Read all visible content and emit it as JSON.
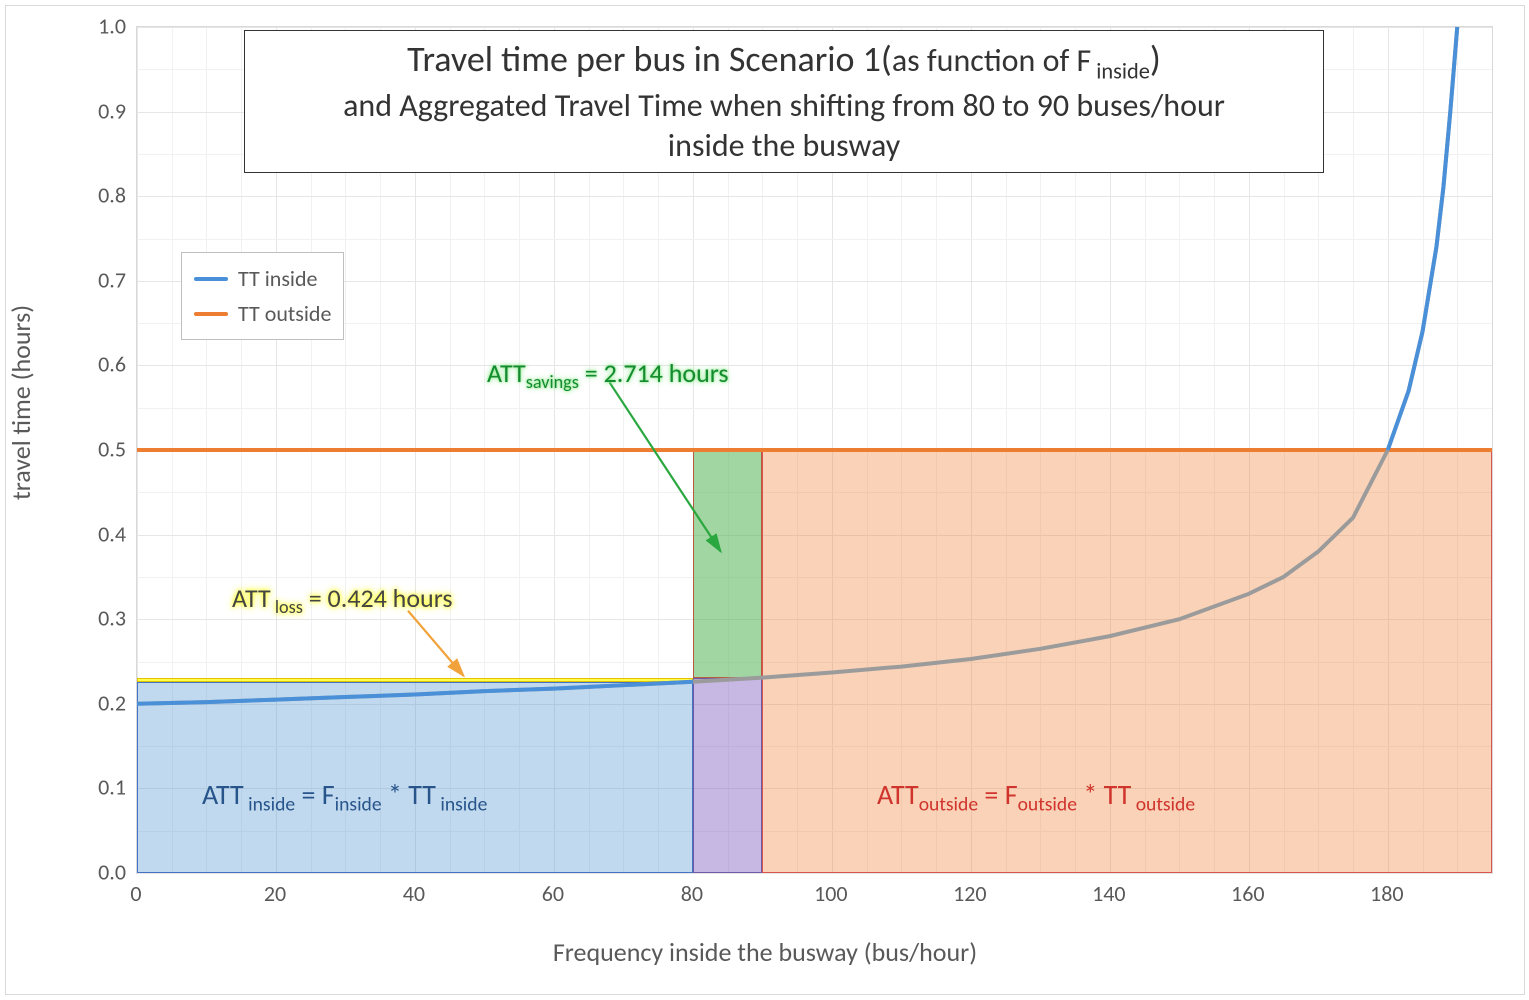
{
  "title_line1_a": "Travel time per bus in Scenario 1(",
  "title_line1_b": "as function of F",
  "title_line1_sub": " inside",
  "title_line1_c": ")",
  "title_line2": "and Aggregated Travel Time when shifting from 80 to 90 buses/hour",
  "title_line3": "inside the busway",
  "x_axis_label": "Frequency inside the busway (bus/hour)",
  "y_axis_label": "travel time  (hours)",
  "legend": {
    "inside": "TT inside",
    "outside": "TT outside"
  },
  "annotations": {
    "savings_prefix": "ATT",
    "savings_sub": "savings",
    "savings_rest": " = 2.714 hours",
    "loss_prefix": "ATT",
    "loss_sub": " loss",
    "loss_rest": " = 0.424 hours",
    "inside_prefix": "ATT",
    "inside_sub": " inside",
    "inside_mid": " = F",
    "inside_sub2": "inside",
    "inside_mid2": " * TT",
    "inside_sub3": " inside",
    "outside_prefix": "ATT",
    "outside_sub": "outside",
    "outside_mid": " = F",
    "outside_sub2": "outside",
    "outside_mid2": " * TT",
    "outside_sub3": " outside"
  },
  "x_ticks": [
    "0",
    "20",
    "40",
    "60",
    "80",
    "100",
    "120",
    "140",
    "160",
    "180"
  ],
  "y_ticks": [
    "0.0",
    "0.1",
    "0.2",
    "0.3",
    "0.4",
    "0.5",
    "0.6",
    "0.7",
    "0.8",
    "0.9",
    "1.0"
  ],
  "chart_data": {
    "type": "line",
    "xlabel": "Frequency inside the busway (bus/hour)",
    "ylabel": "travel time (hours)",
    "xlim": [
      0,
      195
    ],
    "ylim": [
      0.0,
      1.0
    ],
    "series": [
      {
        "name": "TT outside",
        "color": "#ed7d31",
        "x": [
          0,
          195
        ],
        "values": [
          0.5,
          0.5
        ]
      },
      {
        "name": "TT inside",
        "color": "#4a90d9",
        "x": [
          0,
          10,
          20,
          30,
          40,
          50,
          60,
          70,
          80,
          90,
          100,
          110,
          120,
          130,
          140,
          150,
          160,
          165,
          170,
          175,
          180,
          183,
          185,
          187,
          188,
          189,
          190
        ],
        "values": [
          0.2,
          0.202,
          0.205,
          0.208,
          0.211,
          0.215,
          0.218,
          0.222,
          0.226,
          0.231,
          0.237,
          0.244,
          0.253,
          0.265,
          0.28,
          0.3,
          0.33,
          0.35,
          0.38,
          0.42,
          0.5,
          0.57,
          0.64,
          0.74,
          0.81,
          0.9,
          1.0
        ]
      }
    ],
    "regions": [
      {
        "name": "ATT_inside",
        "xmin": 0,
        "xmax": 80,
        "ymin": 0.0,
        "ymax": 0.226,
        "fill": "blue"
      },
      {
        "name": "ATT_loss",
        "xmin": 0,
        "xmax": 80,
        "ymin": 0.226,
        "ymax": 0.231,
        "fill": "yellow"
      },
      {
        "name": "ATT_savings",
        "xmin": 80,
        "xmax": 90,
        "ymin": 0.231,
        "ymax": 0.5,
        "fill": "green"
      },
      {
        "name": "ATT_shift_inside",
        "xmin": 80,
        "xmax": 90,
        "ymin": 0.0,
        "ymax": 0.231,
        "fill": "purple"
      },
      {
        "name": "ATT_outside",
        "xmin": 90,
        "xmax": 195,
        "ymin": 0.0,
        "ymax": 0.5,
        "fill": "orange"
      }
    ],
    "annotations": [
      {
        "text": "ATT_savings = 2.714 hours",
        "anchor_x": 85,
        "anchor_y": 0.5
      },
      {
        "text": "ATT_loss = 0.424 hours",
        "anchor_x": 40,
        "anchor_y": 0.228
      },
      {
        "text": "ATT_inside = F_inside * TT_inside",
        "x": 40,
        "y": 0.1
      },
      {
        "text": "ATT_outside = F_outside * TT_outside",
        "x": 140,
        "y": 0.1
      }
    ]
  }
}
